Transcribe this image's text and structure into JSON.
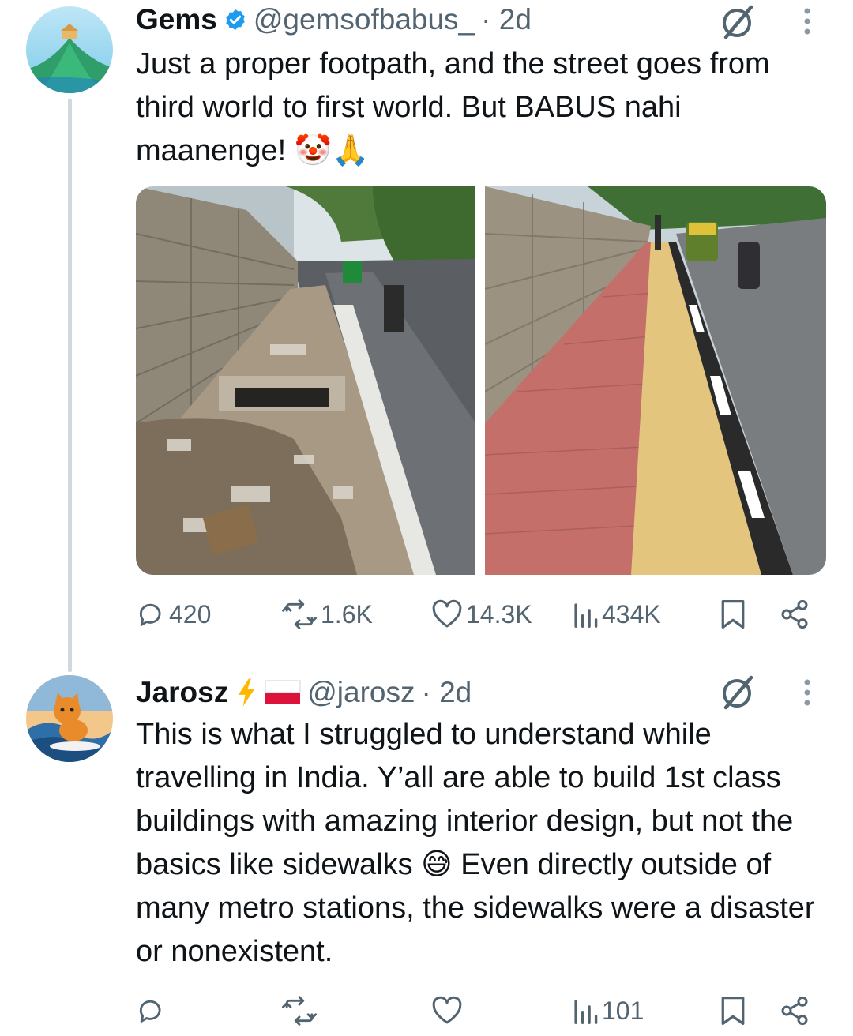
{
  "tweets": [
    {
      "name": "Gems",
      "verified": true,
      "handle": "@gemsofbabus_",
      "time": "· 2d",
      "text": "Just a proper footpath, and the street goes from third world to first world. But BABUS nahi maanenge! 🤡🙏",
      "media": [
        "before-garbage-footpath-photo",
        "after-paved-footpath-photo"
      ],
      "stats": {
        "replies": "420",
        "reposts": "1.6K",
        "likes": "14.3K",
        "views": "434K"
      }
    },
    {
      "name": "Jarosz",
      "badges": [
        "lightning-icon",
        "poland-flag-icon"
      ],
      "handle": "@jarosz",
      "time": "· 2d",
      "text": "This is what I struggled to understand while travelling in India. Y’all are able to build 1st class buildings with amazing interior design, but not the basics like sidewalks 😅 Even directly outside of many metro stations, the sidewalks were a disaster or nonexistent.",
      "stats": {
        "replies": "",
        "reposts": "",
        "likes": "",
        "views": "101"
      }
    }
  ],
  "colors": {
    "text": "#0f1419",
    "secondary": "#536471",
    "verified": "#1d9bf0",
    "thread_line": "#cfd9de",
    "lightning": "#ffb800",
    "flag_red": "#dc143c"
  }
}
